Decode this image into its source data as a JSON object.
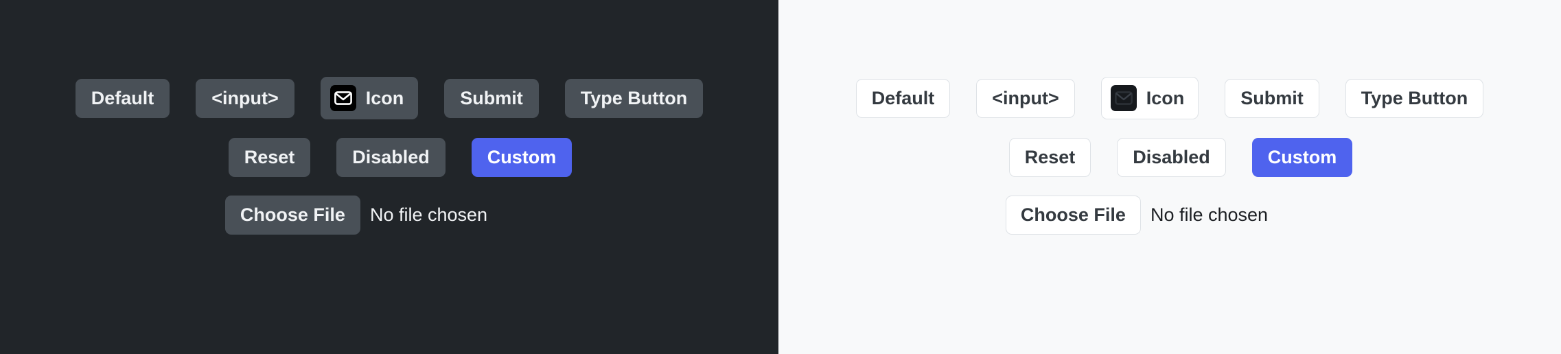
{
  "panels": [
    {
      "theme": "dark",
      "background": "#212529",
      "button_bg": "#495057",
      "button_text": "#f1f3f5",
      "accent": "#4f63ee",
      "rows": [
        [
          {
            "label": "Default",
            "name": "default-button",
            "kind": "plain"
          },
          {
            "label": "<input>",
            "name": "input-button",
            "kind": "plain"
          },
          {
            "label": "Icon",
            "name": "icon-button",
            "kind": "icon",
            "icon": "envelope-icon"
          },
          {
            "label": "Submit",
            "name": "submit-button",
            "kind": "plain"
          },
          {
            "label": "Type Button",
            "name": "type-button",
            "kind": "plain"
          }
        ],
        [
          {
            "label": "Reset",
            "name": "reset-button",
            "kind": "plain"
          },
          {
            "label": "Disabled",
            "name": "disabled-button",
            "kind": "plain"
          },
          {
            "label": "Custom",
            "name": "custom-button",
            "kind": "custom"
          }
        ]
      ],
      "file_input": {
        "button_label": "Choose File",
        "status_text": "No file chosen"
      }
    },
    {
      "theme": "light",
      "background": "#f8f9fa",
      "button_bg": "#ffffff",
      "button_text": "#343a40",
      "button_border": "#dee2e6",
      "accent": "#4f63ee",
      "rows": [
        [
          {
            "label": "Default",
            "name": "default-button",
            "kind": "plain"
          },
          {
            "label": "<input>",
            "name": "input-button",
            "kind": "plain"
          },
          {
            "label": "Icon",
            "name": "icon-button",
            "kind": "icon",
            "icon": "envelope-icon"
          },
          {
            "label": "Submit",
            "name": "submit-button",
            "kind": "plain"
          },
          {
            "label": "Type Button",
            "name": "type-button",
            "kind": "plain"
          }
        ],
        [
          {
            "label": "Reset",
            "name": "reset-button",
            "kind": "plain"
          },
          {
            "label": "Disabled",
            "name": "disabled-button",
            "kind": "plain"
          },
          {
            "label": "Custom",
            "name": "custom-button",
            "kind": "custom"
          }
        ]
      ],
      "file_input": {
        "button_label": "Choose File",
        "status_text": "No file chosen"
      }
    }
  ]
}
